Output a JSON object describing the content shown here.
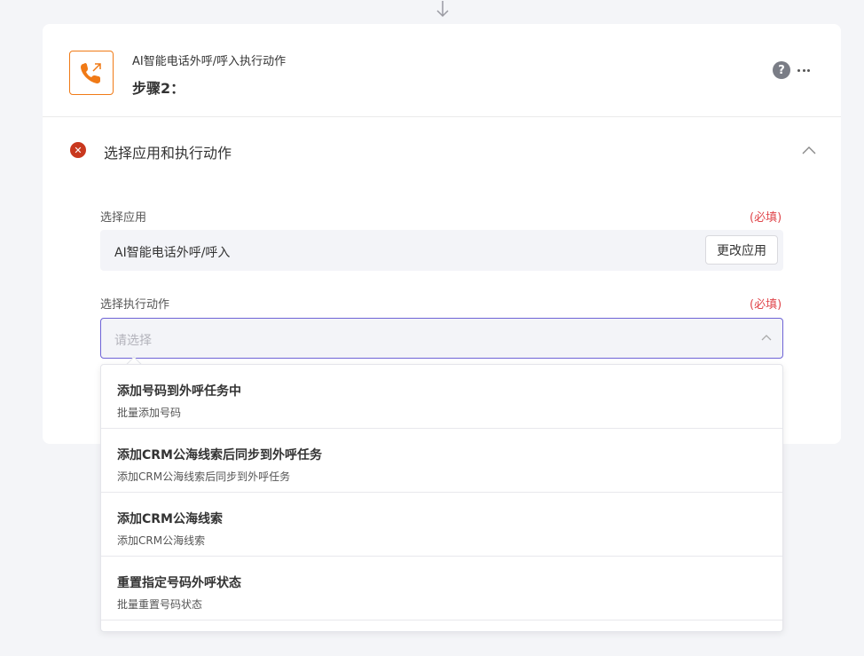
{
  "step": {
    "app_subtitle": "AI智能电话外呼/呼入执行动作",
    "title": "步骤2："
  },
  "header_icons": {
    "help": "?",
    "more": "more-icon"
  },
  "section": {
    "title": "选择应用和执行动作"
  },
  "app_select": {
    "label": "选择应用",
    "required": "(必填)",
    "value": "AI智能电话外呼/呼入",
    "change_button": "更改应用"
  },
  "action_select": {
    "label": "选择执行动作",
    "required": "(必填)",
    "placeholder": "请选择"
  },
  "options": [
    {
      "title": "添加号码到外呼任务中",
      "desc": "批量添加号码"
    },
    {
      "title": "添加CRM公海线索后同步到外呼任务",
      "desc": "添加CRM公海线索后同步到外呼任务"
    },
    {
      "title": "添加CRM公海线索",
      "desc": "添加CRM公海线索"
    },
    {
      "title": "重置指定号码外呼状态",
      "desc": "批量重置号码状态"
    }
  ],
  "colors": {
    "brand": "#f07a16",
    "error": "#c9381e",
    "required": "#e0474c",
    "focus_border": "#6e63d6"
  }
}
